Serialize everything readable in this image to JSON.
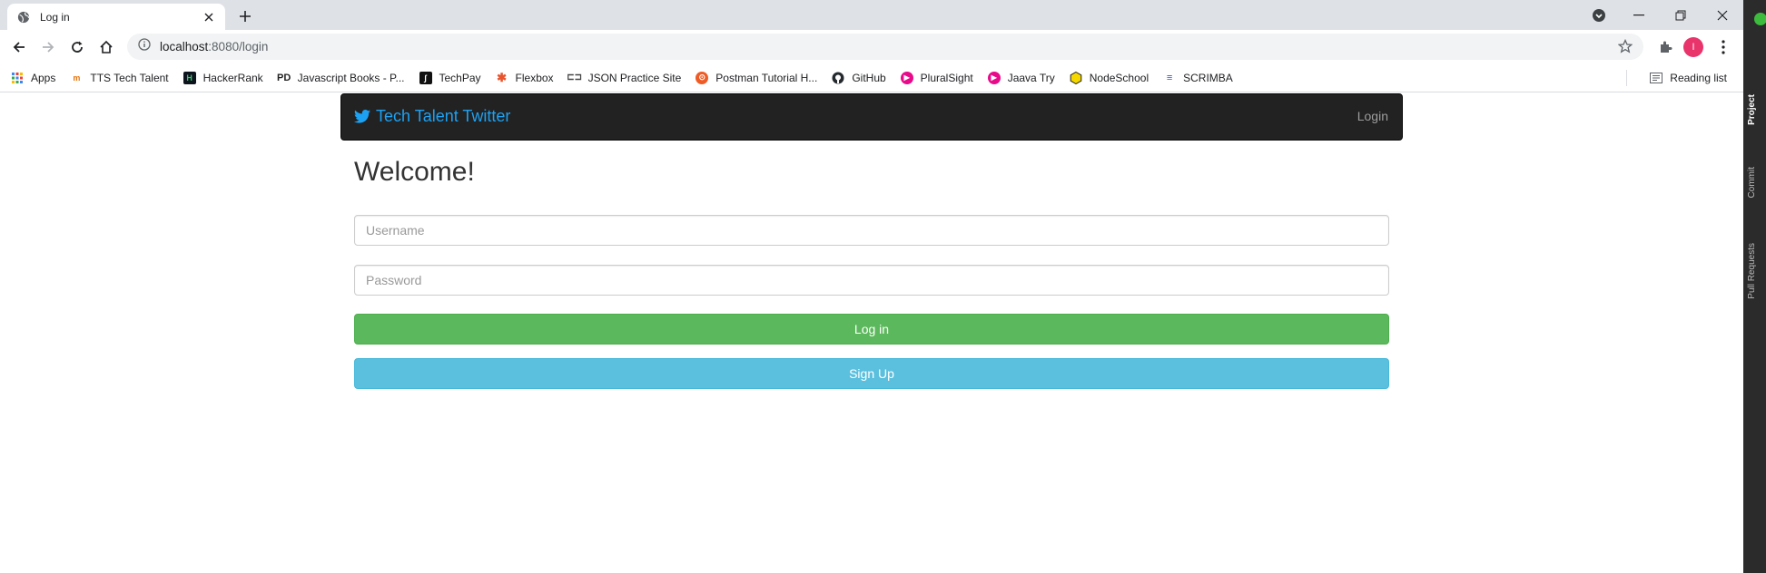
{
  "browser": {
    "tab_title": "Log in",
    "url_host": "localhost",
    "url_rest": ":8080/login",
    "profile_initial": "I",
    "bookmarks": [
      {
        "label": "Apps",
        "icon": "apps-grid-icon",
        "color": "#4285f4"
      },
      {
        "label": "TTS Tech Talent",
        "icon": "tts-icon",
        "color": "#e8710a"
      },
      {
        "label": "HackerRank",
        "icon": "hackerrank-icon",
        "color": "#2ec866"
      },
      {
        "label": "Javascript Books - P...",
        "icon": "pd-icon",
        "color": "#222222"
      },
      {
        "label": "TechPay",
        "icon": "techpay-icon",
        "color": "#111111"
      },
      {
        "label": "Flexbox",
        "icon": "flexbox-icon",
        "color": "#e8542e"
      },
      {
        "label": "JSON Practice Site",
        "icon": "json-icon",
        "color": "#444444"
      },
      {
        "label": "Postman Tutorial H...",
        "icon": "postman-icon",
        "color": "#ef5b25"
      },
      {
        "label": "GitHub",
        "icon": "github-icon",
        "color": "#24292e"
      },
      {
        "label": "PluralSight",
        "icon": "pluralsight-icon",
        "color": "#e80a89"
      },
      {
        "label": "Jaava Try",
        "icon": "jaava-icon",
        "color": "#e80a89"
      },
      {
        "label": "NodeSchool",
        "icon": "nodeschool-icon",
        "color": "#f5d800"
      },
      {
        "label": "SCRIMBA",
        "icon": "scrimba-icon",
        "color": "#2b4fff"
      }
    ],
    "reading_list": "Reading list"
  },
  "ide": {
    "labels": [
      "Project",
      "Commit",
      "Pull Requests"
    ]
  },
  "app": {
    "brand": "Tech Talent Twitter",
    "nav_login": "Login",
    "heading": "Welcome!",
    "username_placeholder": "Username",
    "password_placeholder": "Password",
    "login_button": "Log in",
    "signup_button": "Sign Up",
    "colors": {
      "brand": "#1da1f2",
      "navbar": "#222222",
      "login": "#5cb85c",
      "signup": "#5bc0de"
    }
  }
}
